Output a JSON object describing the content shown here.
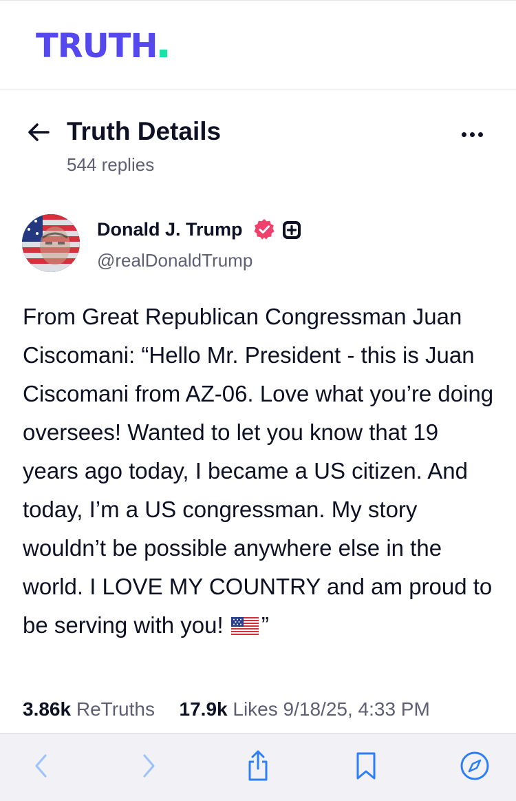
{
  "app": {
    "logo_text": "TRUTH",
    "brand_color": "#5448ee",
    "brand_dot_color": "#17e3a8"
  },
  "header": {
    "title": "Truth Details",
    "replies": "544 replies",
    "back_icon": "arrow-left-icon",
    "more_icon": "ellipsis-icon"
  },
  "post": {
    "author_name": "Donald J. Trump",
    "handle": "@realDonaldTrump",
    "verified_color": "#f0416c",
    "body_text": "From Great Republican Congressman Juan Ciscomani: “Hello Mr. President - this is Juan Ciscomani from AZ-06. Love what you’re doing oversees!  Wanted to let you know that 19 years ago today, I became a US citizen. And today, I’m a US congressman. My story wouldn’t be possible anywhere else in the world. I LOVE MY COUNTRY and am proud to be serving with you!",
    "body_suffix": "”",
    "flag_icon": "us-flag-icon",
    "retruths_count": "3.86k",
    "retruths_label": "ReTruths",
    "likes_count": "17.9k",
    "likes_label": "Likes",
    "timestamp": "9/18/25, 4:33 PM"
  },
  "browser_bar": {
    "accent_color": "#2d7ff9",
    "icons": [
      "back-icon",
      "forward-icon",
      "share-icon",
      "bookmarks-icon",
      "compass-icon"
    ]
  }
}
